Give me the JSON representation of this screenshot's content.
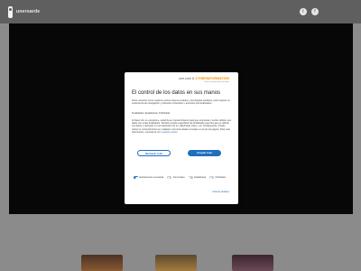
{
  "header": {
    "logo_text": "uneroarde",
    "social": [
      {
        "icon": "twitter-icon",
        "glyph": "t"
      },
      {
        "icon": "facebook-icon",
        "glyph": "f"
      }
    ]
  },
  "consent": {
    "brand": "one.com",
    "brand_separator": "&",
    "brand_partner": "OTHERINFORMATION",
    "brand_sub": "Zona de protección de datos",
    "title": "El control de los datos en sus manos",
    "para1": "Tanto nosotros como nuestros socios usamos cookies y tecnologías similares, para mejorar su experiencia de navegación y ofrecerle contenidos y anuncios personalizados.",
    "para2": "Finalidades: Estadísticas, Publicidad",
    "para3": "Al hacer clic en «Aceptar», usted da su consentimiento para que empresas y socios utilicen sus datos con estas finalidades. También puede especificar las finalidades para las que se utilizan sus datos o rechazar su uso haciendo clic en «Rechazar todo» o en Configuración. Puede retirar su consentimiento en cualquier momento desde el enlace en el pie de página. Para más información, consulte la",
    "para3_link": "Ver nuestros socios",
    "reject_label": "Rechazar todo",
    "accept_label": "Aceptar todo",
    "toggles": [
      {
        "label": "Estrictamente necesarias",
        "on": true
      },
      {
        "label": "Funcionales",
        "on": false
      },
      {
        "label": "Estadísticas",
        "on": false
      },
      {
        "label": "Publicidad",
        "on": false
      }
    ],
    "more_label": "Mostrar detalles"
  }
}
